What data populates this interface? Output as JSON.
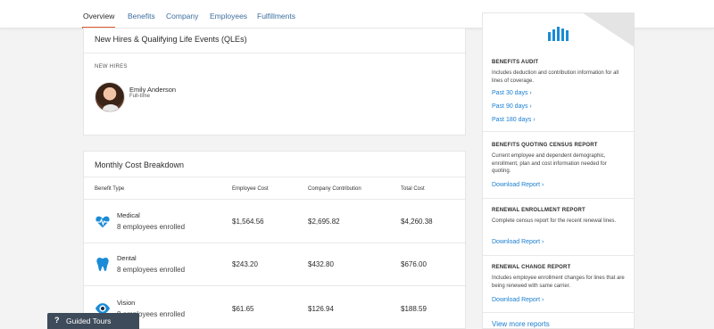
{
  "nav": {
    "tabs": [
      {
        "label": "Overview"
      },
      {
        "label": "Benefits"
      },
      {
        "label": "Company"
      },
      {
        "label": "Employees"
      },
      {
        "label": "Fulfillments"
      }
    ],
    "active_tab": "Overview"
  },
  "qle": {
    "title": "New Hires & Qualifying Life Events (QLEs)",
    "section_label": "NEW HIRES",
    "hire": {
      "name": "Emily Anderson",
      "status": "Full-time"
    }
  },
  "cost": {
    "title": "Monthly Cost Breakdown",
    "headers": [
      "Benefit Type",
      "Employee Cost",
      "Company Contribution",
      "Total Cost"
    ],
    "rows": [
      {
        "icon": "heart-pulse-icon",
        "name": "Medical",
        "enrolled": "8 employees enrolled",
        "employee_cost": "$1,564.56",
        "company": "$2,695.82",
        "total": "$4,260.38"
      },
      {
        "icon": "tooth-icon",
        "name": "Dental",
        "enrolled": "8 employees enrolled",
        "employee_cost": "$243.20",
        "company": "$432.80",
        "total": "$676.00"
      },
      {
        "icon": "eye-icon",
        "name": "Vision",
        "enrolled": "8 employees enrolled",
        "employee_cost": "$61.65",
        "company": "$126.94",
        "total": "$188.59"
      }
    ]
  },
  "reports": {
    "benefits_audit": {
      "title": "BENEFITS AUDIT",
      "desc": "Includes deduction and contribution information for all lines of coverage.",
      "links": [
        "Past 30 days",
        "Past 90 days",
        "Past 180 days"
      ]
    },
    "census": {
      "title": "BENEFITS QUOTING CENSUS REPORT",
      "desc": "Current employee and dependent demographic, enrollment, plan and cost information needed for quoting.",
      "link": "Download Report"
    },
    "renewal_enrollment": {
      "title": "RENEWAL ENROLLMENT REPORT",
      "desc": "Complete census report for the recent renewal lines.",
      "link": "Download Report"
    },
    "renewal_change": {
      "title": "RENEWAL CHANGE REPORT",
      "desc": "Includes employee enrollment changes for lines that are being renewed with same carrier.",
      "link": "Download Report"
    },
    "view_more": "View more reports"
  },
  "guided_tours": {
    "label": "Guided Tours",
    "icon": "?"
  },
  "colors": {
    "accent": "#e4572e",
    "link": "#1a7ed0",
    "icon_blue": "#1a8bd6",
    "dark": "#3d4b5a"
  }
}
